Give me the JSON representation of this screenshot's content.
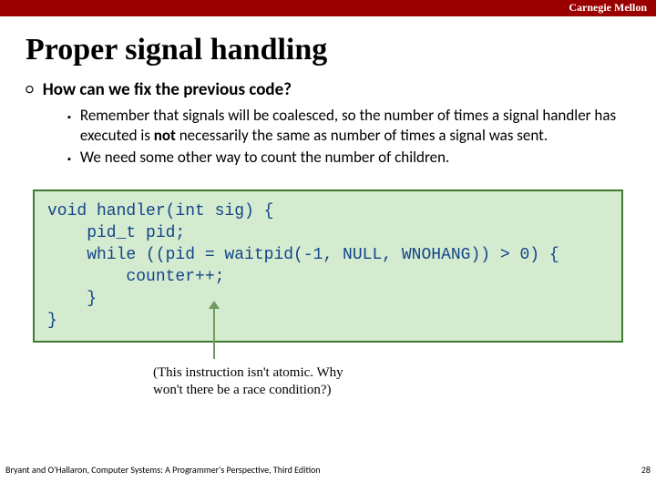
{
  "brand": "Carnegie Mellon",
  "title": "Proper signal handling",
  "bullets": {
    "l1": "How can we fix the previous code?",
    "l2a": "Remember that signals will be coalesced, so the number of times a signal handler has executed is not necessarily the same as number of times a signal was sent.",
    "l2b": "We need some other way to count the number of children."
  },
  "code": "void handler(int sig) {\n    pid_t pid;\n    while ((pid = waitpid(-1, NULL, WNOHANG)) > 0) {\n        counter++;\n    }\n}",
  "caption_line1": "(This instruction isn't atomic. Why",
  "caption_line2": "won't there be a race condition?)",
  "footer_source": "Bryant and O'Hallaron, Computer Systems: A Programmer's Perspective, Third Edition",
  "page_number": "28"
}
